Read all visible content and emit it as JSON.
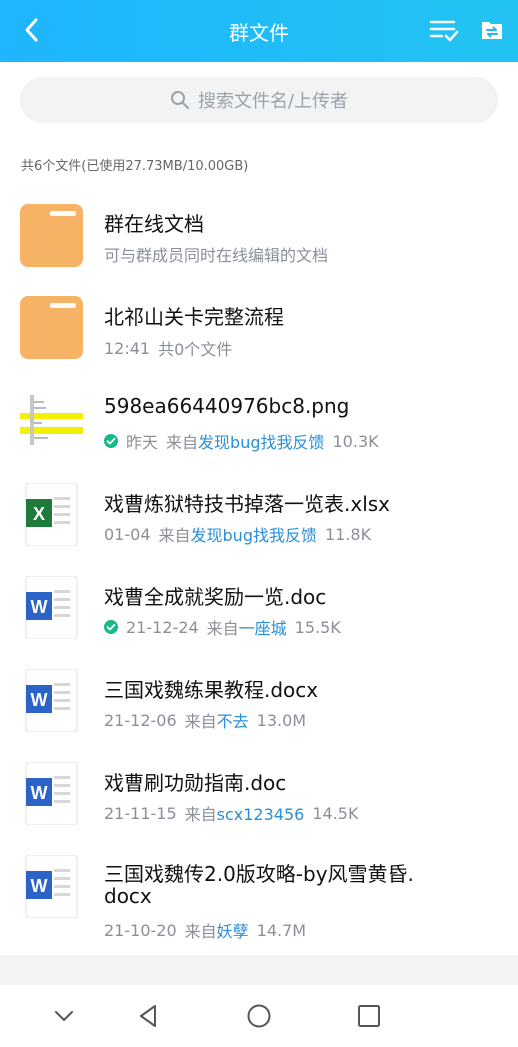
{
  "header": {
    "title": "群文件"
  },
  "search": {
    "placeholder": "搜索文件名/上传者"
  },
  "summary": "共6个文件(已使用27.73MB/10.00GB)",
  "files": [
    {
      "name": "群在线文档",
      "meta": {
        "text": "可与群成员同时在线编辑的文档"
      },
      "type": "folder"
    },
    {
      "name": "北祁山关卡完整流程",
      "meta": {
        "date": "12:41",
        "count": "共0个文件"
      },
      "type": "folder"
    },
    {
      "name": "598ea66440976bc8.png",
      "meta": {
        "checked": true,
        "date": "昨天",
        "from": "来自",
        "uploader": "发现bug找我反馈",
        "size": "10.3K"
      },
      "type": "image"
    },
    {
      "name": "戏曹炼狱特技书掉落一览表.xlsx",
      "meta": {
        "date": "01-04",
        "from": "来自",
        "uploader": "发现bug找我反馈",
        "size": "11.8K"
      },
      "type": "excel"
    },
    {
      "name": "戏曹全成就奖励一览.doc",
      "meta": {
        "checked": true,
        "date": "21-12-24",
        "from": "来自",
        "uploader": "一座城",
        "size": "15.5K"
      },
      "type": "word"
    },
    {
      "name": "三国戏魏练果教程.docx",
      "meta": {
        "date": "21-12-06",
        "from": "来自",
        "uploader": "不去",
        "size": "13.0M"
      },
      "type": "word"
    },
    {
      "name": "戏曹刷功勋指南.doc",
      "meta": {
        "date": "21-11-15",
        "from": "来自",
        "uploader": "scx123456",
        "size": "14.5K"
      },
      "type": "word"
    },
    {
      "name_line1": "三国戏魏传2.0版攻略-by风雪黄昏.",
      "name_line2": "docx",
      "meta": {
        "date": "21-10-20",
        "from": "来自",
        "uploader": "妖孽",
        "size": "14.7M"
      },
      "type": "word"
    }
  ],
  "icons": {
    "word_letter": "W",
    "excel_letter": "X"
  },
  "colors": {
    "header": "#22b8f5",
    "link": "#2a8fd6",
    "folder": "#f7b365",
    "word": "#2b63c9",
    "excel": "#1e7b3a",
    "check": "#19b88a"
  }
}
